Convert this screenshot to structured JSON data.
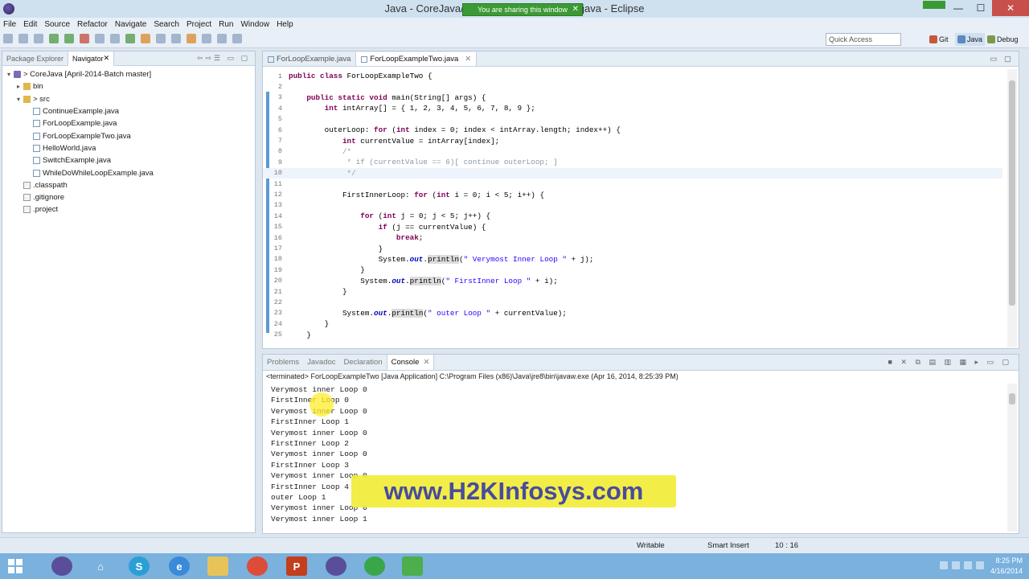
{
  "window": {
    "title": "Java - CoreJava/src/ForLoopExampleTwo.java - Eclipse",
    "sharing_banner": "You are sharing this window",
    "sharing_close": "✕",
    "minimize": "—",
    "maximize": "☐",
    "close": "✕"
  },
  "menu": [
    "File",
    "Edit",
    "Source",
    "Refactor",
    "Navigate",
    "Search",
    "Project",
    "Run",
    "Window",
    "Help"
  ],
  "toolbar": {
    "quick_access_placeholder": "Quick Access",
    "perspectives": [
      "Git",
      "Java",
      "Debug"
    ]
  },
  "left_panel": {
    "tabs": [
      "Package Explorer",
      "Navigator"
    ],
    "tree": [
      {
        "label": "> CoreJava  [April-2014-Batch master]",
        "icon": "project-icon",
        "level": 0,
        "toggle": "▾"
      },
      {
        "label": "bin",
        "icon": "folder-icon",
        "level": 1,
        "toggle": "▸"
      },
      {
        "label": "> src",
        "icon": "folder-icon",
        "level": 1,
        "toggle": "▾"
      },
      {
        "label": "ContinueExample.java",
        "icon": "java-file-icon",
        "level": 2,
        "toggle": ""
      },
      {
        "label": "ForLoopExample.java",
        "icon": "java-file-icon",
        "level": 2,
        "toggle": ""
      },
      {
        "label": "ForLoopExampleTwo.java",
        "icon": "java-file-icon",
        "level": 2,
        "toggle": ""
      },
      {
        "label": "HelloWorld.java",
        "icon": "java-file-icon",
        "level": 2,
        "toggle": ""
      },
      {
        "label": "SwitchExample.java",
        "icon": "java-file-icon",
        "level": 2,
        "toggle": ""
      },
      {
        "label": "WhileDoWhileLoopExample.java",
        "icon": "java-file-icon",
        "level": 2,
        "toggle": ""
      },
      {
        "label": ".classpath",
        "icon": "file-icon",
        "level": 1,
        "toggle": ""
      },
      {
        "label": ".gitignore",
        "icon": "file-icon",
        "level": 1,
        "toggle": ""
      },
      {
        "label": ".project",
        "icon": "file-icon",
        "level": 1,
        "toggle": ""
      }
    ]
  },
  "editor": {
    "tabs": [
      {
        "label": "ForLoopExample.java",
        "active": false
      },
      {
        "label": "ForLoopExampleTwo.java",
        "active": true
      }
    ],
    "lines": [
      {
        "n": "1",
        "segs": [
          [
            "kw",
            "public class "
          ],
          [
            "",
            "ForLoopExampleTwo {"
          ]
        ]
      },
      {
        "n": "2",
        "segs": []
      },
      {
        "n": "3",
        "segs": [
          [
            "",
            "    "
          ],
          [
            "kw",
            "public static void "
          ],
          [
            "",
            "main(String[] args) {"
          ]
        ]
      },
      {
        "n": "4",
        "segs": [
          [
            "",
            "        "
          ],
          [
            "kw",
            "int "
          ],
          [
            "",
            "intArray[] = { 1, 2, 3, 4, 5, 6, 7, 8, 9 };"
          ]
        ]
      },
      {
        "n": "5",
        "segs": []
      },
      {
        "n": "6",
        "segs": [
          [
            "",
            "        outerLoop: "
          ],
          [
            "kw",
            "for "
          ],
          [
            "",
            "("
          ],
          [
            "kw",
            "int "
          ],
          [
            "",
            "index = 0; index < intArray.length; index++) {"
          ]
        ]
      },
      {
        "n": "7",
        "segs": [
          [
            "",
            "            "
          ],
          [
            "kw",
            "int "
          ],
          [
            "",
            "currentValue = intArray[index];"
          ]
        ]
      },
      {
        "n": "8",
        "segs": [
          [
            "cm",
            "            /*"
          ]
        ]
      },
      {
        "n": "9",
        "segs": [
          [
            "cm",
            "             * if (currentValue == 6)[ continue outerLoop; ]"
          ]
        ]
      },
      {
        "n": "10",
        "segs": [
          [
            "cm",
            "             */"
          ]
        ],
        "cur": true
      },
      {
        "n": "11",
        "segs": []
      },
      {
        "n": "12",
        "segs": [
          [
            "",
            "            FirstInnerLoop: "
          ],
          [
            "kw",
            "for "
          ],
          [
            "",
            "("
          ],
          [
            "kw",
            "int "
          ],
          [
            "",
            "i = 0; i < 5; i++) {"
          ]
        ]
      },
      {
        "n": "13",
        "segs": []
      },
      {
        "n": "14",
        "segs": [
          [
            "",
            "                "
          ],
          [
            "kw",
            "for "
          ],
          [
            "",
            "("
          ],
          [
            "kw",
            "int "
          ],
          [
            "",
            "j = 0; j < 5; j++) {"
          ]
        ]
      },
      {
        "n": "15",
        "segs": [
          [
            "",
            "                    "
          ],
          [
            "kw",
            "if "
          ],
          [
            "",
            "(j == currentValue) {"
          ]
        ]
      },
      {
        "n": "16",
        "segs": [
          [
            "",
            "                        "
          ],
          [
            "kw",
            "break"
          ],
          [
            "",
            ";"
          ]
        ]
      },
      {
        "n": "17",
        "segs": [
          [
            "",
            "                    }"
          ]
        ]
      },
      {
        "n": "18",
        "segs": [
          [
            "",
            "                    System."
          ],
          [
            "fld",
            "out"
          ],
          [
            "",
            "."
          ],
          [
            "mth",
            "println"
          ],
          [
            "",
            "("
          ],
          [
            "str",
            "\" Verymost Inner Loop \""
          ],
          [
            "",
            " + j);"
          ]
        ]
      },
      {
        "n": "19",
        "segs": [
          [
            "",
            "                }"
          ]
        ]
      },
      {
        "n": "20",
        "segs": [
          [
            "",
            "                System."
          ],
          [
            "fld",
            "out"
          ],
          [
            "",
            "."
          ],
          [
            "mth",
            "println"
          ],
          [
            "",
            "("
          ],
          [
            "str",
            "\" FirstInner Loop \""
          ],
          [
            "",
            " + i);"
          ]
        ]
      },
      {
        "n": "21",
        "segs": [
          [
            "",
            "            }"
          ]
        ]
      },
      {
        "n": "22",
        "segs": []
      },
      {
        "n": "23",
        "segs": [
          [
            "",
            "            System."
          ],
          [
            "fld",
            "out"
          ],
          [
            "",
            "."
          ],
          [
            "mth",
            "println"
          ],
          [
            "",
            "("
          ],
          [
            "str",
            "\" outer Loop \""
          ],
          [
            "",
            " + currentValue);"
          ]
        ]
      },
      {
        "n": "24",
        "segs": [
          [
            "",
            "        }"
          ]
        ]
      },
      {
        "n": "25",
        "segs": [
          [
            "",
            "    }"
          ]
        ]
      }
    ]
  },
  "console": {
    "tabs": [
      {
        "label": "Problems",
        "active": false
      },
      {
        "label": "Javadoc",
        "active": false
      },
      {
        "label": "Declaration",
        "active": false
      },
      {
        "label": "Console",
        "active": true
      }
    ],
    "terminated": "<terminated> ForLoopExampleTwo [Java Application] C:\\Program Files (x86)\\Java\\jre8\\bin\\javaw.exe (Apr 16, 2014, 8:25:39 PM)",
    "output": [
      "Verymost inner Loop 0",
      "FirstInner Loop 0",
      "Verymost inner Loop 0",
      "FirstInner Loop 1",
      "Verymost inner Loop 0",
      "FirstInner Loop 2",
      "Verymost inner Loop 0",
      "FirstInner Loop 3",
      "Verymost inner Loop 0",
      "FirstInner Loop 4",
      "outer Loop 1",
      "Verymost inner Loop 0",
      "Verymost inner Loop 1"
    ]
  },
  "watermark": "www.H2KInfosys.com",
  "statusbar": {
    "writable": "Writable",
    "insert_mode": "Smart Insert",
    "position": "10 : 16"
  },
  "taskbar": {
    "time": "8:25 PM",
    "date": "4/16/2014"
  },
  "colors": {
    "keyword": "#7f0055",
    "comment": "#8a9aa6",
    "string": "#2a00ff",
    "field": "#0000c0",
    "watermark_bg": "#f3ec3a",
    "watermark_fg": "#3a3f98",
    "taskbar": "#7ab1dd"
  }
}
